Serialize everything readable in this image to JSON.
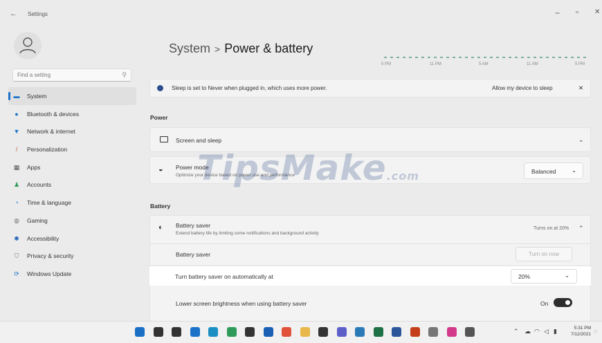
{
  "window": {
    "app_title": "Settings",
    "minimize": "−",
    "maximize": "▫",
    "close": "✕"
  },
  "sidebar": {
    "search_placeholder": "Find a setting",
    "items": [
      {
        "label": "System",
        "icon": "system-icon",
        "color": "#1a73c8",
        "active": true
      },
      {
        "label": "Bluetooth & devices",
        "icon": "bluetooth-icon",
        "color": "#1a73c8"
      },
      {
        "label": "Network & internet",
        "icon": "wifi-icon",
        "color": "#1a73c8"
      },
      {
        "label": "Personalization",
        "icon": "brush-icon",
        "color": "#c0603a"
      },
      {
        "label": "Apps",
        "icon": "apps-icon",
        "color": "#555555"
      },
      {
        "label": "Accounts",
        "icon": "accounts-icon",
        "color": "#2e9b5a"
      },
      {
        "label": "Time & language",
        "icon": "globe-clock-icon",
        "color": "#1a73c8"
      },
      {
        "label": "Gaming",
        "icon": "gamepad-icon",
        "color": "#777777"
      },
      {
        "label": "Accessibility",
        "icon": "accessibility-icon",
        "color": "#1a5fb4"
      },
      {
        "label": "Privacy & security",
        "icon": "shield-icon",
        "color": "#777777"
      },
      {
        "label": "Windows Update",
        "icon": "update-icon",
        "color": "#1a73c8"
      }
    ]
  },
  "header": {
    "parent": "System",
    "separator": ">",
    "current": "Power & battery"
  },
  "usage_chart": {
    "ticks": [
      "5 PM",
      "11 PM",
      "5 AM",
      "11 AM",
      "5 PM"
    ]
  },
  "notice": {
    "text": "Sleep is set to Never when plugged in, which uses more power.",
    "action": "Allow my device to sleep",
    "dismiss": "✕"
  },
  "power": {
    "section_label": "Power",
    "screen_sleep": "Screen and sleep",
    "power_mode_title": "Power mode",
    "power_mode_desc": "Optimize your device based on power use and performance",
    "power_mode_value": "Balanced"
  },
  "battery": {
    "section_label": "Battery",
    "saver_title": "Battery saver",
    "saver_desc": "Extend battery life by limiting some notifications and background activity",
    "saver_status": "Turns on at 20%",
    "saver_row": "Battery saver",
    "turn_on_now": "Turn on now",
    "auto_label": "Turn battery saver on automatically at",
    "auto_value": "20%",
    "brightness_label": "Lower screen brightness when using battery saver",
    "brightness_state": "On"
  },
  "watermark": {
    "text": "TipsMake",
    "suffix": ".com"
  },
  "taskbar": {
    "time": "5:31 PM",
    "date": "7/12/2021",
    "icons": [
      {
        "name": "start-icon",
        "color": "#1a6fc4"
      },
      {
        "name": "search-icon",
        "color": "#333333"
      },
      {
        "name": "task-view-icon",
        "color": "#333333"
      },
      {
        "name": "widgets-icon",
        "color": "#1a73c8"
      },
      {
        "name": "edge-icon",
        "color": "#1b8fc4"
      },
      {
        "name": "xbox-icon",
        "color": "#2e9b5a"
      },
      {
        "name": "store-icon",
        "color": "#333333"
      },
      {
        "name": "mail-icon",
        "color": "#1a5fb4"
      },
      {
        "name": "photos-icon",
        "color": "#e0523a"
      },
      {
        "name": "file-explorer-icon",
        "color": "#e8b84a"
      },
      {
        "name": "terminal-icon",
        "color": "#333333"
      },
      {
        "name": "teams-icon",
        "color": "#5b5fc7"
      },
      {
        "name": "notepad-icon",
        "color": "#2a7ab8"
      },
      {
        "name": "excel-icon",
        "color": "#1e7145"
      },
      {
        "name": "word-icon",
        "color": "#2b579a"
      },
      {
        "name": "powerpoint-icon",
        "color": "#c43e1c"
      },
      {
        "name": "snipping-icon",
        "color": "#777777"
      },
      {
        "name": "paint-icon",
        "color": "#d43a8a"
      },
      {
        "name": "settings-icon",
        "color": "#555555"
      }
    ]
  }
}
